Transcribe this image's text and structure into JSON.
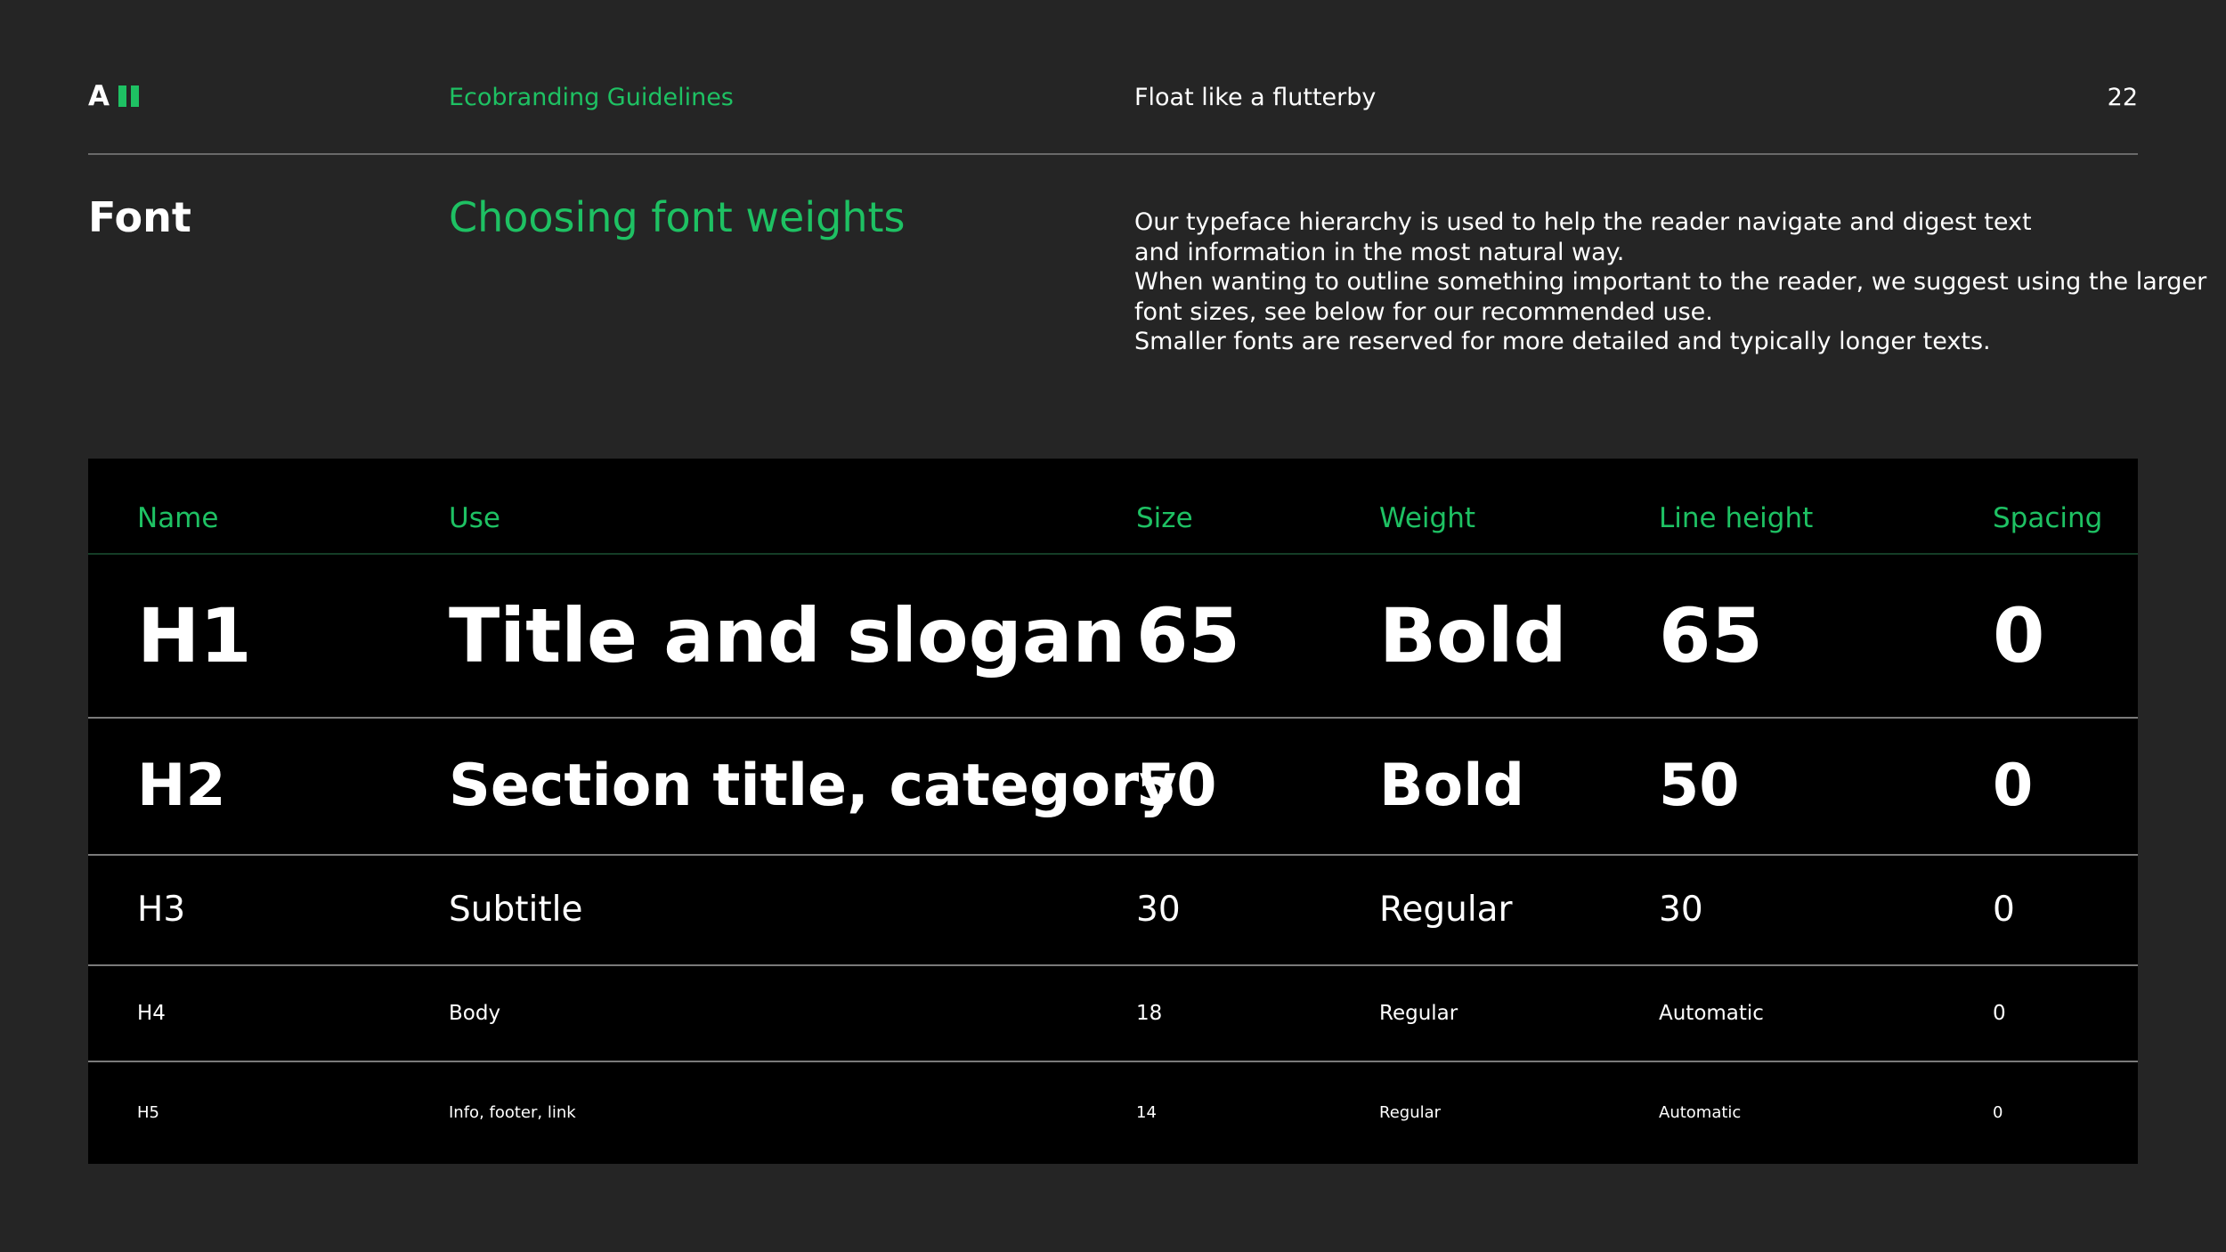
{
  "header": {
    "logo_letter": "A",
    "doc_name": "Ecobranding Guidelines",
    "tagline": "Float like a flutterby",
    "page_number": "22"
  },
  "section": {
    "label": "Font",
    "title": "Choosing font weights",
    "intro": [
      "Our typeface hierarchy is used to help the reader navigate and digest text",
      "and information in the most natural way.",
      "When wanting to outline something important to the reader, we suggest using the larger",
      "font sizes, see below for our recommended use.",
      "Smaller fonts are reserved for more detailed and typically longer texts."
    ]
  },
  "table": {
    "columns": [
      "Name",
      "Use",
      "Size",
      "Weight",
      "Line height",
      "Spacing"
    ],
    "rows": [
      {
        "name": "H1",
        "use": "Title and slogan",
        "size": "65",
        "weight": "Bold",
        "line_height": "65",
        "spacing": "0"
      },
      {
        "name": "H2",
        "use": "Section title, category",
        "size": "50",
        "weight": "Bold",
        "line_height": "50",
        "spacing": "0"
      },
      {
        "name": "H3",
        "use": "Subtitle",
        "size": "30",
        "weight": "Regular",
        "line_height": "30",
        "spacing": "0"
      },
      {
        "name": "H4",
        "use": "Body",
        "size": "18",
        "weight": "Regular",
        "line_height": "Automatic",
        "spacing": "0"
      },
      {
        "name": "H5",
        "use": "Info, footer, link",
        "size": "14",
        "weight": "Regular",
        "line_height": "Automatic",
        "spacing": "0"
      }
    ]
  },
  "colors": {
    "background": "#252525",
    "accent": "#1ec163",
    "table_background": "#000000",
    "text": "#ffffff"
  }
}
